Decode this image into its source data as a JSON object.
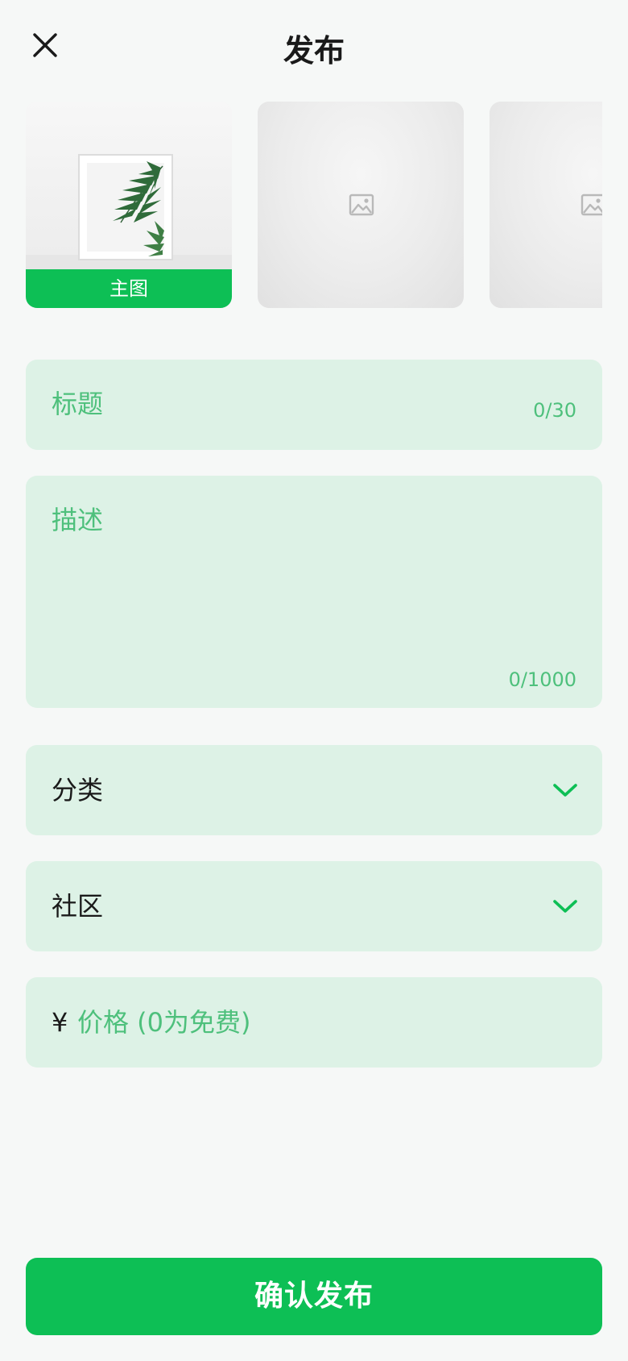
{
  "header": {
    "title": "发布",
    "close_icon": "close-icon"
  },
  "images": {
    "main_badge": "主图",
    "placeholder_icon": "image-placeholder-icon"
  },
  "form": {
    "title": {
      "placeholder": "标题",
      "counter": "0/30"
    },
    "description": {
      "placeholder": "描述",
      "counter": "0/1000"
    },
    "category": {
      "label": "分类",
      "icon": "chevron-down-icon"
    },
    "community": {
      "label": "社区",
      "icon": "chevron-down-icon"
    },
    "price": {
      "currency": "¥",
      "placeholder": "价格 (0为免费)"
    }
  },
  "submit": {
    "label": "确认发布"
  },
  "colors": {
    "accent": "#0dbf55",
    "field_bg": "#ddf2e6",
    "placeholder": "#4ec07c",
    "page_bg": "#f6f8f7"
  }
}
